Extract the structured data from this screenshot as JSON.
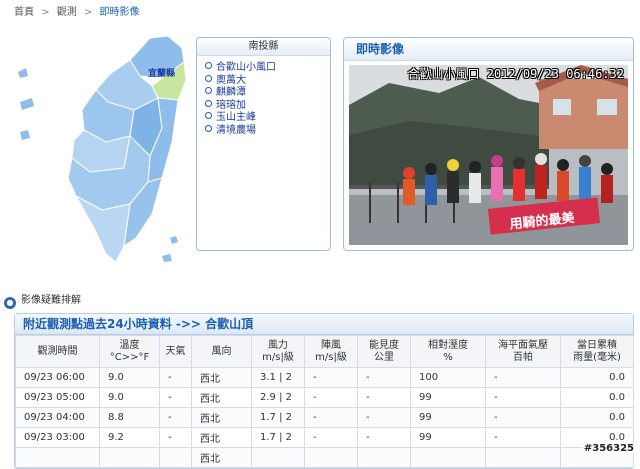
{
  "breadcrumb": [
    "首頁",
    "觀測",
    "即時影像"
  ],
  "map": {
    "selected_label": "宜蘭縣",
    "highlight_color": "#c9e6a0",
    "base_color": "#8fbdeb"
  },
  "county_panel": {
    "title": "南投縣",
    "items": [
      "合歡山小風口",
      "奧萬大",
      "麒麟潭",
      "瑢瑢加",
      "玉山主峰",
      "清境農場"
    ]
  },
  "live_panel": {
    "title": "即時影像",
    "camera_caption": "合歡山小風口 2012/09/23 06:46:32",
    "banner_text": "用騎的最美"
  },
  "trouble_link": "影像疑難排解",
  "obs": {
    "title": "附近觀測點過去24小時資料 ->> 合歡山頂",
    "headers": [
      [
        "觀測時間"
      ],
      [
        "溫度",
        "°C>>°F"
      ],
      [
        "天氣"
      ],
      [
        "風向"
      ],
      [
        "風力",
        "m/s|級"
      ],
      [
        "陣風",
        "m/s|級"
      ],
      [
        "能見度",
        "公里"
      ],
      [
        "相對溼度",
        "%"
      ],
      [
        "海平面氣壓",
        "百帕"
      ],
      [
        "當日累積",
        "雨量(毫米)"
      ]
    ],
    "rows": [
      [
        "09/23 06:00",
        "9.0",
        "-",
        "西北",
        "3.1 | 2",
        "-",
        "-",
        "100",
        "-",
        "0.0"
      ],
      [
        "09/23 05:00",
        "9.0",
        "-",
        "西北",
        "2.9 | 2",
        "-",
        "-",
        "99",
        "-",
        "0.0"
      ],
      [
        "09/23 04:00",
        "8.8",
        "-",
        "西北",
        "1.7 | 2",
        "-",
        "-",
        "99",
        "-",
        "0.0"
      ],
      [
        "09/23 03:00",
        "9.2",
        "-",
        "西北",
        "1.7 | 2",
        "-",
        "-",
        "99",
        "-",
        "0.0"
      ],
      [
        "",
        "",
        "",
        "西北",
        "",
        "",
        "",
        "",
        "",
        ""
      ]
    ]
  },
  "watermark": "#356325"
}
